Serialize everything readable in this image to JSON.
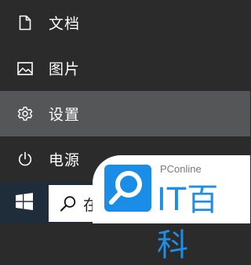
{
  "menu": {
    "items": [
      {
        "icon": "document-icon",
        "label": "文档"
      },
      {
        "icon": "picture-icon",
        "label": "图片"
      },
      {
        "icon": "gear-icon",
        "label": "设置"
      },
      {
        "icon": "power-icon",
        "label": "电源"
      }
    ],
    "selected_index": 2,
    "highlight_color": "#555658",
    "background_color": "#2b2b2b"
  },
  "taskbar": {
    "start_icon": "windows-logo-icon",
    "search_icon": "search-icon",
    "search_text": "在",
    "background_color": "#1f2d3b"
  },
  "watermark": {
    "brand": "PConline",
    "name": "IT百科",
    "accent_color": "#1a8ee6"
  }
}
